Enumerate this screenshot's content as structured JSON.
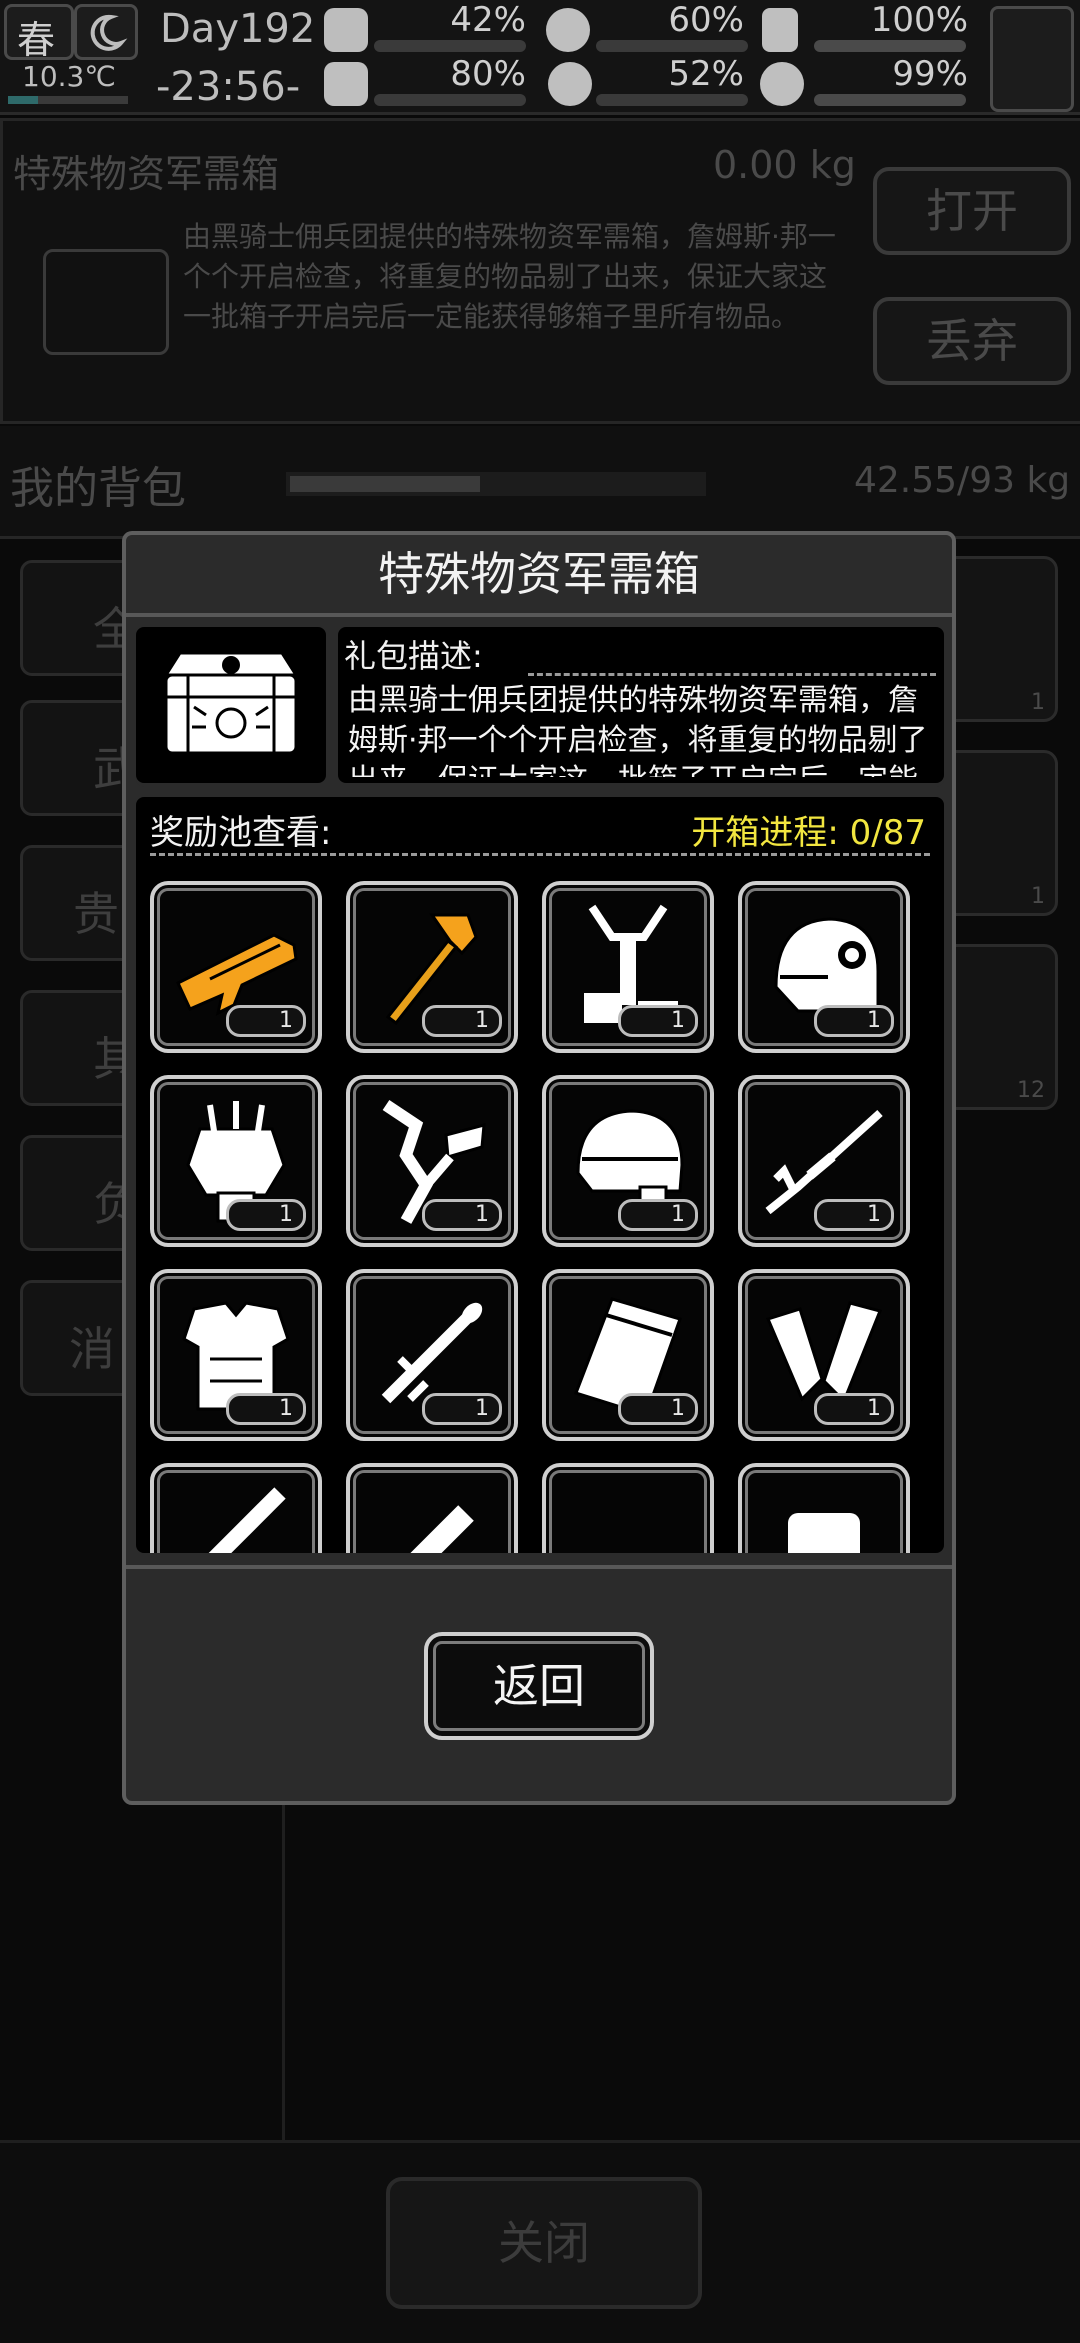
{
  "status_bar": {
    "season": "春",
    "day": "Day192",
    "temperature": "10.3℃",
    "clock": "-23:56-",
    "stats": [
      {
        "icon": "medkit-icon",
        "value": "42%"
      },
      {
        "icon": "stomach-icon",
        "value": "60%"
      },
      {
        "icon": "battery-icon",
        "value": "100%"
      },
      {
        "icon": "boot-icon",
        "value": "80%"
      },
      {
        "icon": "water-drop-icon",
        "value": "52%"
      },
      {
        "icon": "heart-icon",
        "value": "99%"
      }
    ]
  },
  "background": {
    "item_name": "特殊物资军需箱",
    "item_weight": "0.00 kg",
    "item_desc": "由黑骑士佣兵团提供的特殊物资军需箱，詹姆斯·邦一个个开启检查，将重复的物品剔了出来，保证大家这一批箱子开启完后一定能获得够箱子里所有物品。",
    "open_button": "打开",
    "discard_button": "丢弃",
    "backpack_title": "我的背包",
    "backpack_weight": "42.55/93 kg",
    "side_tabs": [
      "全",
      "武",
      "贵",
      "其",
      "负",
      "消"
    ],
    "slot_counts": [
      "1",
      "1",
      "12"
    ],
    "close_button": "关闭"
  },
  "modal": {
    "title": "特殊物资军需箱",
    "desc_label": "礼包描述:",
    "desc_text": "由黑骑士佣兵团提供的特殊物资军需箱，詹姆斯·邦一个个开启检查，将重复的物品剔了出来，保证大家这一批箱子开启完后一定能获得够箱子里所有物品。",
    "pool_label": "奖励池查看:",
    "progress_label": "开箱进程: 0/87",
    "rewards": [
      {
        "name": "golden-shotgun",
        "count": "1"
      },
      {
        "name": "golden-sledgehammer",
        "count": "1"
      },
      {
        "name": "exoskeleton-frame",
        "count": "1"
      },
      {
        "name": "combat-helmet",
        "count": "1"
      },
      {
        "name": "power-armor-back",
        "count": "1"
      },
      {
        "name": "mechanical-arm",
        "count": "1"
      },
      {
        "name": "tactical-helmet",
        "count": "1"
      },
      {
        "name": "sniper-rifle",
        "count": "1"
      },
      {
        "name": "body-armor",
        "count": "1"
      },
      {
        "name": "rocket-launcher",
        "count": "1"
      },
      {
        "name": "armored-case",
        "count": "1"
      },
      {
        "name": "arm-guards",
        "count": "1"
      },
      {
        "name": "minigun",
        "count": ""
      },
      {
        "name": "spiked-club",
        "count": ""
      },
      {
        "name": "heavy-rifle",
        "count": ""
      },
      {
        "name": "backpack",
        "count": ""
      }
    ],
    "back_button": "返回"
  },
  "colors": {
    "progress": "#f2e640",
    "gold_item": "#f5a21c"
  }
}
